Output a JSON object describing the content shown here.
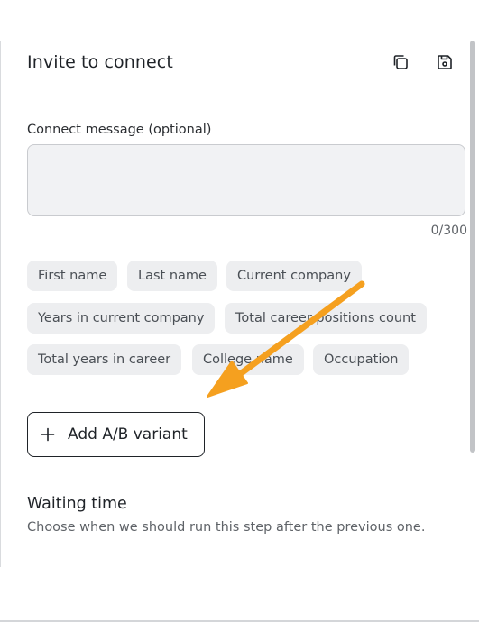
{
  "header": {
    "title": "Invite to connect",
    "copy_icon": "copy-icon",
    "save_icon": "save-icon"
  },
  "message": {
    "label": "Connect message (optional)",
    "value": "",
    "placeholder": "",
    "counter": "0/300"
  },
  "variables": [
    "First name",
    "Last name",
    "Current company",
    "Years in current company",
    "Total career positions count",
    "Total years in career",
    "College name",
    "Occupation"
  ],
  "ab_variant": {
    "label": "Add A/B variant",
    "icon": "plus-icon"
  },
  "waiting": {
    "title": "Waiting time",
    "description": "Choose when we should run this step after the previous one."
  },
  "colors": {
    "annotation_arrow": "#f5a01f",
    "chip_bg": "#edeef0",
    "input_bg": "#f1f2f4"
  }
}
